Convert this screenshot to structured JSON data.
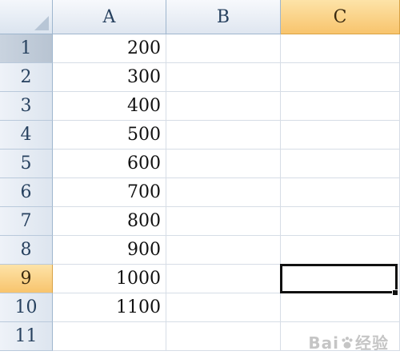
{
  "columns": [
    {
      "label": "A",
      "selected": false
    },
    {
      "label": "B",
      "selected": false
    },
    {
      "label": "C",
      "selected": true
    }
  ],
  "rows": [
    {
      "label": "1",
      "A": "200",
      "B": "",
      "C": ""
    },
    {
      "label": "2",
      "A": "300",
      "B": "",
      "C": ""
    },
    {
      "label": "3",
      "A": "400",
      "B": "",
      "C": ""
    },
    {
      "label": "4",
      "A": "500",
      "B": "",
      "C": ""
    },
    {
      "label": "5",
      "A": "600",
      "B": "",
      "C": ""
    },
    {
      "label": "6",
      "A": "700",
      "B": "",
      "C": ""
    },
    {
      "label": "7",
      "A": "800",
      "B": "",
      "C": ""
    },
    {
      "label": "8",
      "A": "900",
      "B": "",
      "C": ""
    },
    {
      "label": "9",
      "A": "1000",
      "B": "",
      "C": ""
    },
    {
      "label": "10",
      "A": "1100",
      "B": "",
      "C": ""
    },
    {
      "label": "11",
      "A": "",
      "B": "",
      "C": ""
    }
  ],
  "active_cell": {
    "column": "C",
    "row": "9"
  },
  "watermark": {
    "text_left": "Bai",
    "text_right": "经验"
  },
  "colors": {
    "header_selected": "#f8c46d",
    "grid_line": "#d6dde6",
    "header_border": "#9eb6ce"
  }
}
